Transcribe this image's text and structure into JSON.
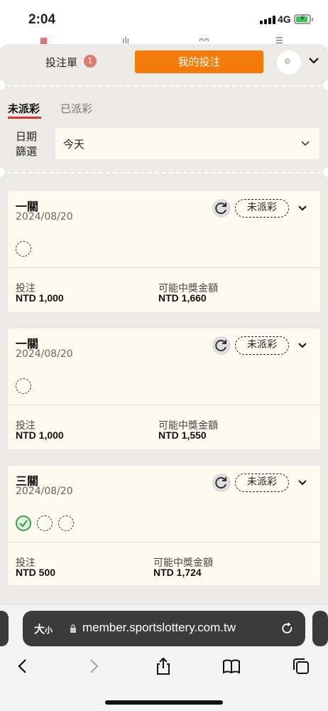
{
  "status_bar": {
    "time": "2:04",
    "network": "4G"
  },
  "header": {
    "betslip_label": "投注單",
    "betslip_count": "1",
    "mybets_label": "我的投注",
    "accent": "#f47b0a"
  },
  "tabs": [
    {
      "label": "未派彩",
      "active": true
    },
    {
      "label": "已派彩",
      "active": false
    }
  ],
  "filter": {
    "label": "日期篩選",
    "value": "今天"
  },
  "bets": [
    {
      "title": "一關",
      "date": "2024/08/20",
      "status": "未派彩",
      "legs": [
        "pending"
      ],
      "stake_label": "投注",
      "stake": "NTD 1,000",
      "payout_label": "可能中獎金額",
      "payout": "NTD 1,660"
    },
    {
      "title": "一關",
      "date": "2024/08/20",
      "status": "未派彩",
      "legs": [
        "pending"
      ],
      "stake_label": "投注",
      "stake": "NTD 1,000",
      "payout_label": "可能中獎金額",
      "payout": "NTD 1,550"
    },
    {
      "title": "三關",
      "date": "2024/08/20",
      "status": "未派彩",
      "legs": [
        "won",
        "pending",
        "pending"
      ],
      "stake_label": "投注",
      "stake": "NTD 500",
      "payout_label": "可能中獎金額",
      "payout": "NTD 1,724"
    }
  ],
  "browser": {
    "reader_label": "大",
    "reader_small": "小",
    "url": "member.sportslottery.com.tw"
  },
  "icons": [
    "refresh-icon",
    "chevron-down-icon",
    "settings-icon",
    "lock-icon",
    "reload-icon",
    "back-icon",
    "forward-icon",
    "share-icon",
    "bookmarks-icon",
    "tabs-icon"
  ]
}
